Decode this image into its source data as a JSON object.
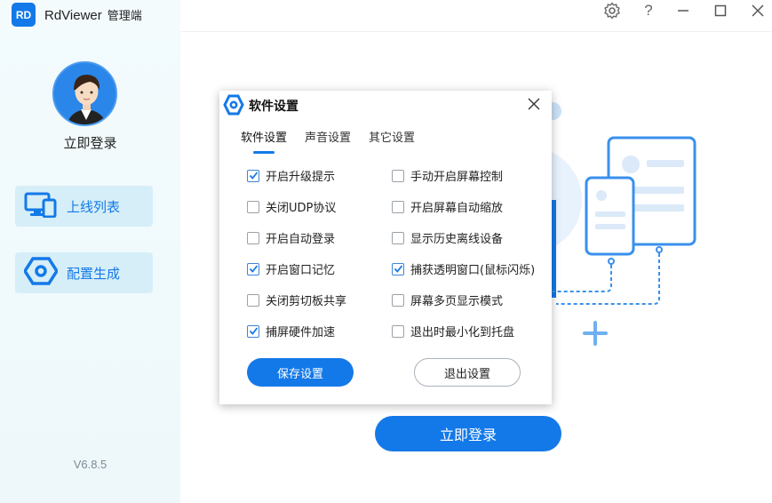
{
  "app": {
    "logo_text": "RD",
    "name": "RdViewer",
    "role": "管理端",
    "version": "V6.8.5"
  },
  "sidebar": {
    "login_label": "立即登录",
    "items": [
      {
        "label": "上线列表",
        "icon": "devices-icon"
      },
      {
        "label": "配置生成",
        "icon": "hexagon-gear-icon"
      }
    ]
  },
  "window_controls": [
    "settings-icon",
    "help-icon",
    "minimize-icon",
    "maximize-icon",
    "close-icon"
  ],
  "main": {
    "login_button": "立即登录"
  },
  "dialog": {
    "title": "软件设置",
    "tabs": [
      {
        "label": "软件设置",
        "active": true
      },
      {
        "label": "声音设置",
        "active": false
      },
      {
        "label": "其它设置",
        "active": false
      }
    ],
    "options": [
      {
        "label": "开启升级提示",
        "checked": true
      },
      {
        "label": "手动开启屏幕控制",
        "checked": false
      },
      {
        "label": "关闭UDP协议",
        "checked": false
      },
      {
        "label": "开启屏幕自动缩放",
        "checked": false
      },
      {
        "label": "开启自动登录",
        "checked": false
      },
      {
        "label": "显示历史离线设备",
        "checked": false
      },
      {
        "label": "开启窗口记忆",
        "checked": true
      },
      {
        "label": "捕获透明窗口(鼠标闪烁)",
        "checked": true
      },
      {
        "label": "关闭剪切板共享",
        "checked": false
      },
      {
        "label": "屏幕多页显示模式",
        "checked": false
      },
      {
        "label": "捕屏硬件加速",
        "checked": true
      },
      {
        "label": "退出时最小化到托盘",
        "checked": false
      }
    ],
    "save_button": "保存设置",
    "exit_button": "退出设置"
  },
  "colors": {
    "accent": "#1479e8",
    "sidebar_bg": "#f3fbfd",
    "sidebar_item_bg": "#d6eef7"
  }
}
